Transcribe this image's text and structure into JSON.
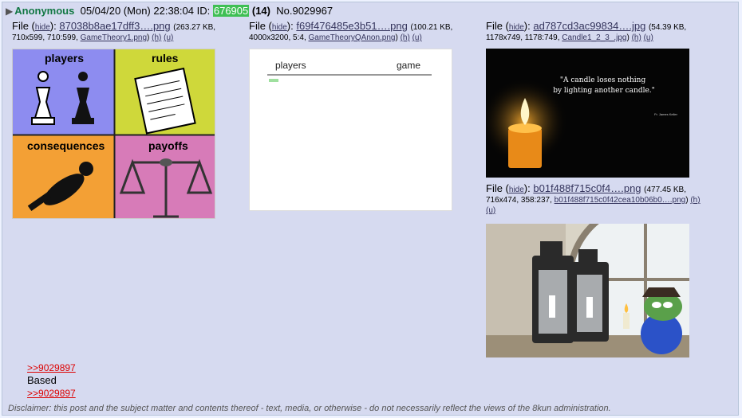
{
  "post": {
    "name": "Anonymous",
    "date": "05/04/20 (Mon) 22:38:04",
    "id_label": "ID:",
    "id": "676905",
    "count": "(14)",
    "number": "No.9029967"
  },
  "files": [
    {
      "prefix": "File (",
      "hide": "hide",
      "name": "87038b8ae17dff3….png",
      "size": "(263.27 KB,",
      "meta": "710x599, 710:599,",
      "orig": "GameTheory1.png",
      "h": "(h)",
      "u": "(u)",
      "labels": [
        "players",
        "rules",
        "consequences",
        "payoffs"
      ]
    },
    {
      "prefix": "File (",
      "hide": "hide",
      "name": "f69f476485e3b51….png",
      "size": "(100.21 KB,",
      "meta": "4000x3200, 5:4,",
      "orig": "GameTheoryQAnon.png",
      "h": "(h)",
      "u": "(u)",
      "labels": [
        "players",
        "game"
      ]
    },
    {
      "prefix": "File (",
      "hide": "hide",
      "name": "ad787cd3ac99834….jpg",
      "size": "(54.39 KB,",
      "meta": "1178x749, 1178:749,",
      "orig": "Candle1_2_3_.jpg",
      "h": "(h)",
      "u": "(u)",
      "quote": "\"A candle loses nothing by lighting another candle.\"",
      "attribution": "Fr. James Keller"
    },
    {
      "prefix": "File (",
      "hide": "hide",
      "name": "b01f488f715c0f4….png",
      "size": "(477.45 KB,",
      "meta": "716x474, 358:237,",
      "orig": "b01f488f715c0f42cea10b06b0….png",
      "h": "(h)",
      "u": "(u)"
    }
  ],
  "body": {
    "quote1": ">>9029897",
    "text": "Based",
    "quote2": ">>9029897"
  },
  "disclaimer": "Disclaimer: this post and the subject matter and contents thereof - text, media, or otherwise - do not necessarily reflect the views of the 8kun administration."
}
